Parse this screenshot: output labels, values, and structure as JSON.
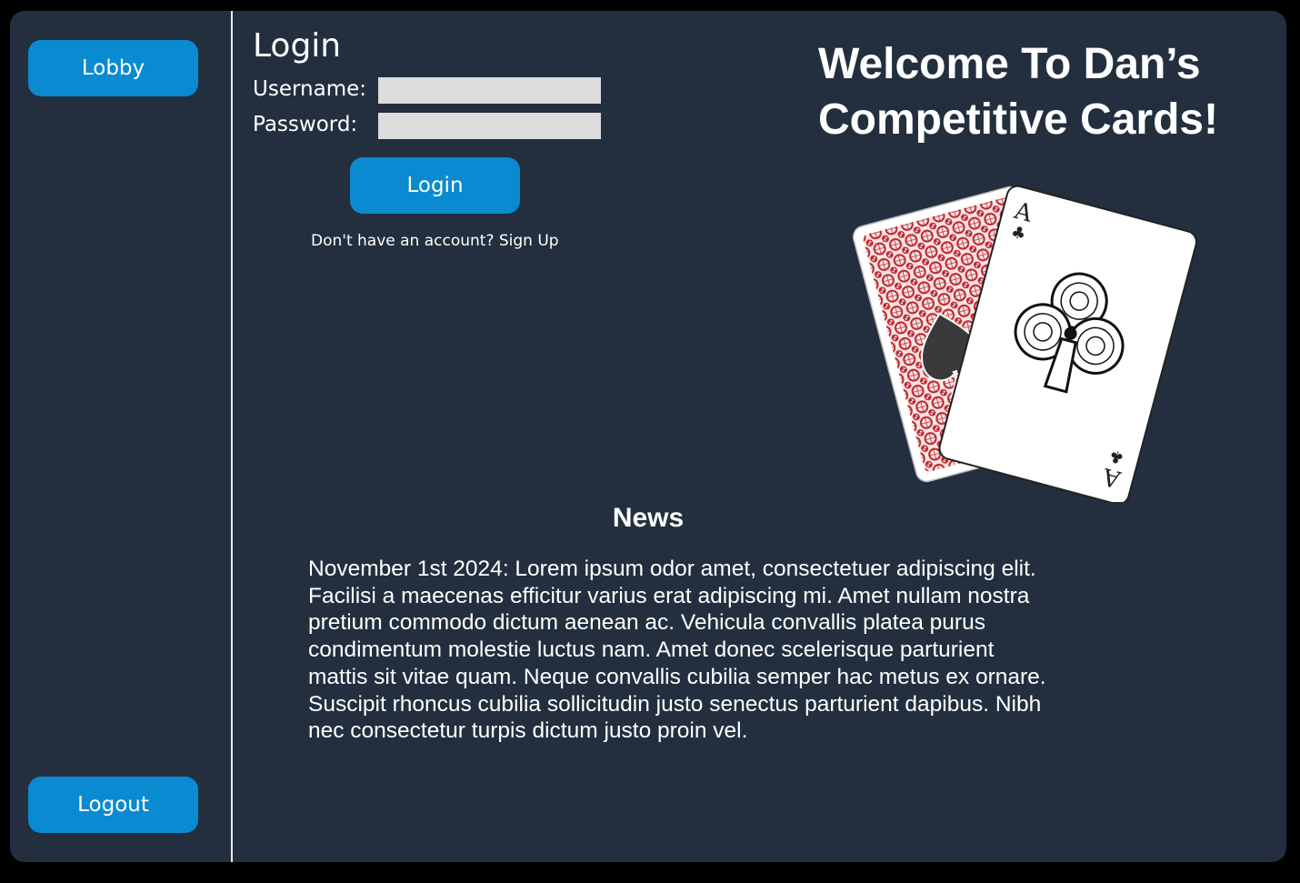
{
  "sidebar": {
    "lobby_label": "Lobby",
    "logout_label": "Logout"
  },
  "login": {
    "title": "Login",
    "username_label": "Username:",
    "username_value": "",
    "password_label": "Password:",
    "password_value": "",
    "button_label": "Login",
    "signup_prompt": "Don't have an account?",
    "signup_link": "Sign Up"
  },
  "hero": {
    "welcome_line1": "Welcome To Dan’s",
    "welcome_line2": "Competitive Cards!",
    "card_front_rank": "A",
    "card_front_suit": "clubs",
    "card_back_pattern": "red-lace-with-spade"
  },
  "news": {
    "title": "News",
    "body": "November 1st 2024: Lorem ipsum odor amet, consectetuer adipiscing elit. Facilisi a maecenas efficitur varius erat adipiscing mi. Amet nullam nostra pretium commodo dictum aenean ac. Vehicula convallis platea purus condimentum molestie luctus nam. Amet donec scelerisque parturient mattis sit vitae quam. Neque convallis cubilia semper hac metus ex ornare. Suscipit rhoncus cubilia sollicitudin justo senectus parturient dapibus. Nibh nec consectetur turpis dictum justo proin vel."
  },
  "colors": {
    "background": "#232f3e",
    "accent": "#0a8ad0",
    "input_fill": "#dcdcdc",
    "card_back": "#c0262d"
  }
}
